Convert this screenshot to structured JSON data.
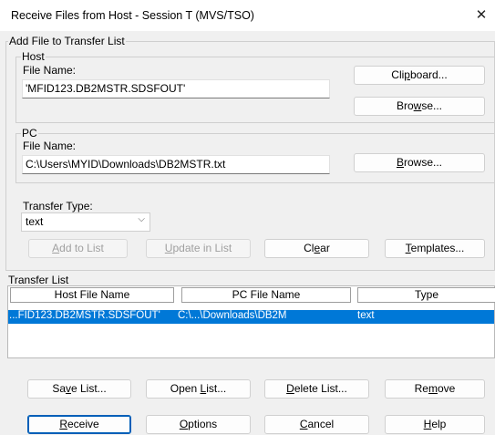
{
  "window": {
    "title": "Receive Files from Host - Session T (MVS/TSO)",
    "close_glyph": "✕"
  },
  "add_group": {
    "label": "Add File to Transfer List"
  },
  "host": {
    "label": "Host",
    "file_name_label": "File Name:",
    "file_name_value": "'MFID123.DB2MSTR.SDSFOUT'",
    "clipboard_button": {
      "pre": "Cli",
      "u": "p",
      "post": "board..."
    },
    "browse_button": {
      "pre": "Bro",
      "u": "w",
      "post": "se..."
    }
  },
  "pc": {
    "label": "PC",
    "file_name_label": "File Name:",
    "file_name_value": "C:\\Users\\MYID\\Downloads\\DB2MSTR.txt",
    "browse_button": {
      "pre": "",
      "u": "B",
      "post": "rowse..."
    }
  },
  "transfer_type": {
    "label": "Transfer Type:",
    "value": "text",
    "chevron": "⌵"
  },
  "actions": {
    "add_to_list": {
      "pre": "",
      "u": "A",
      "post": "dd to List"
    },
    "update_in_list": {
      "pre": "",
      "u": "U",
      "post": "pdate in List"
    },
    "clear": {
      "pre": "Cl",
      "u": "e",
      "post": "ar"
    },
    "templates": {
      "pre": "",
      "u": "T",
      "post": "emplates..."
    }
  },
  "transfer_list": {
    "label": "Transfer List",
    "columns": [
      "Host File Name",
      "PC File Name",
      "Type"
    ],
    "rows": [
      {
        "host": "...FID123.DB2MSTR.SDSFOUT'",
        "pc": "C:\\...\\Downloads\\DB2M",
        "type": "text",
        "selected": true
      }
    ]
  },
  "list_buttons": {
    "save_list": {
      "pre": "Sa",
      "u": "v",
      "post": "e List..."
    },
    "open_list": {
      "pre": "Open ",
      "u": "L",
      "post": "ist..."
    },
    "delete_list": {
      "pre": "",
      "u": "D",
      "post": "elete List..."
    },
    "remove": {
      "pre": "Re",
      "u": "m",
      "post": "ove"
    }
  },
  "footer_buttons": {
    "receive": {
      "pre": "",
      "u": "R",
      "post": "eceive"
    },
    "options": {
      "pre": "",
      "u": "O",
      "post": "ptions"
    },
    "cancel": {
      "pre": "",
      "u": "C",
      "post": "ancel"
    },
    "help": {
      "pre": "",
      "u": "H",
      "post": "elp"
    }
  }
}
